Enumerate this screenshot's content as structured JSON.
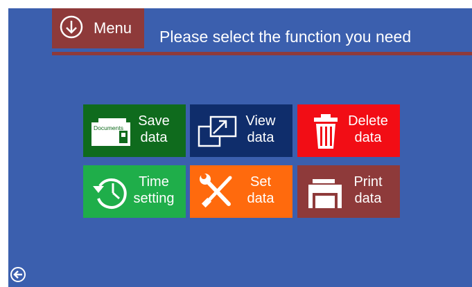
{
  "header": {
    "menu_label": "Menu",
    "title": "Please select the function you need"
  },
  "tiles": [
    {
      "id": "save",
      "line1": "Save",
      "line2": "data",
      "icon": "documents-folder-icon",
      "icon_text": "Documents",
      "color": "#0f6b1d"
    },
    {
      "id": "view",
      "line1": "View",
      "line2": "data",
      "icon": "expand-window-icon",
      "color": "#0f2d6b"
    },
    {
      "id": "delete",
      "line1": "Delete",
      "line2": "data",
      "icon": "trash-can-icon",
      "color": "#f20d15"
    },
    {
      "id": "time",
      "line1": "Time",
      "line2": "setting",
      "icon": "clock-history-icon",
      "color": "#1fae4a"
    },
    {
      "id": "set",
      "line1": "Set",
      "line2": "data",
      "icon": "wrench-screwdriver-icon",
      "color": "#ff6a0d"
    },
    {
      "id": "print",
      "line1": "Print",
      "line2": "data",
      "icon": "printer-icon",
      "color": "#8e3a3a"
    }
  ],
  "footer": {
    "back_icon": "back-arrow-icon"
  },
  "colors": {
    "background": "#3b5fae",
    "accent": "#8e3a3a"
  }
}
